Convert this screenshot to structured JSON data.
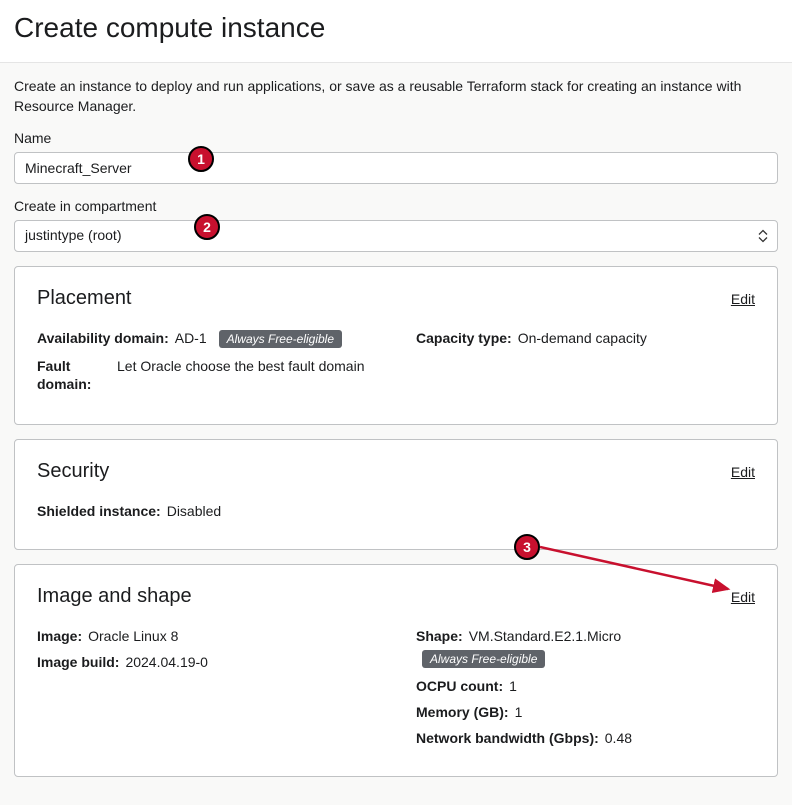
{
  "page": {
    "title": "Create compute instance",
    "description": "Create an instance to deploy and run applications, or save as a reusable Terraform stack for creating an instance with Resource Manager."
  },
  "name_field": {
    "label": "Name",
    "value": "Minecraft_Server"
  },
  "compartment_field": {
    "label": "Create in compartment",
    "value": "justintype (root)"
  },
  "placement": {
    "title": "Placement",
    "edit_label": "Edit",
    "availability_domain": {
      "key": "Availability domain:",
      "value": "AD-1"
    },
    "always_free_badge": "Always Free-eligible",
    "capacity_type": {
      "key": "Capacity type:",
      "value": "On-demand capacity"
    },
    "fault_domain": {
      "key": "Fault domain:",
      "value": "Let Oracle choose the best fault domain"
    }
  },
  "security": {
    "title": "Security",
    "edit_label": "Edit",
    "shielded": {
      "key": "Shielded instance:",
      "value": "Disabled"
    }
  },
  "image_shape": {
    "title": "Image and shape",
    "edit_label": "Edit",
    "image": {
      "key": "Image:",
      "value": "Oracle Linux 8"
    },
    "image_build": {
      "key": "Image build:",
      "value": "2024.04.19-0"
    },
    "shape": {
      "key": "Shape:",
      "value": "VM.Standard.E2.1.Micro"
    },
    "always_free_badge": "Always Free-eligible",
    "ocpu": {
      "key": "OCPU count:",
      "value": "1"
    },
    "memory": {
      "key": "Memory (GB):",
      "value": "1"
    },
    "bandwidth": {
      "key": "Network bandwidth (Gbps):",
      "value": "0.48"
    }
  },
  "annotations": {
    "circle1": "1",
    "circle2": "2",
    "circle3": "3"
  }
}
